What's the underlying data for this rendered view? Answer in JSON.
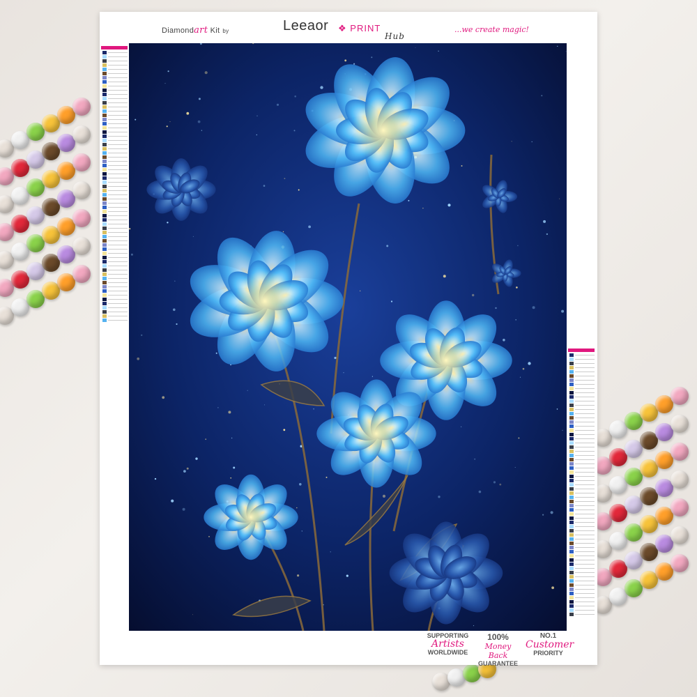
{
  "header": {
    "brand_diamond": "Diamond",
    "brand_art": "art",
    "brand_kit": "Kit",
    "brand_by": "by",
    "brand_name": "Leeaor",
    "brand_print": "PRINT",
    "brand_hub": "Hub",
    "tagline": "...we create magic!"
  },
  "badges": [
    {
      "top": "SUPPORTING",
      "script": "Artists",
      "bottom": "WORLDWIDE"
    },
    {
      "top": "100%",
      "script": "Money Back",
      "bottom": "GUARANTEE"
    },
    {
      "top": "NO.1",
      "script": "Customer",
      "bottom": "PRIORITY"
    }
  ],
  "colors": {
    "accent": "#e0187e",
    "night_sky": "#0a1a4a",
    "petal_blue": "#5ec8ff",
    "glow": "#fff2b0"
  },
  "illustration": {
    "subject": "glowing blue flowers at night"
  }
}
